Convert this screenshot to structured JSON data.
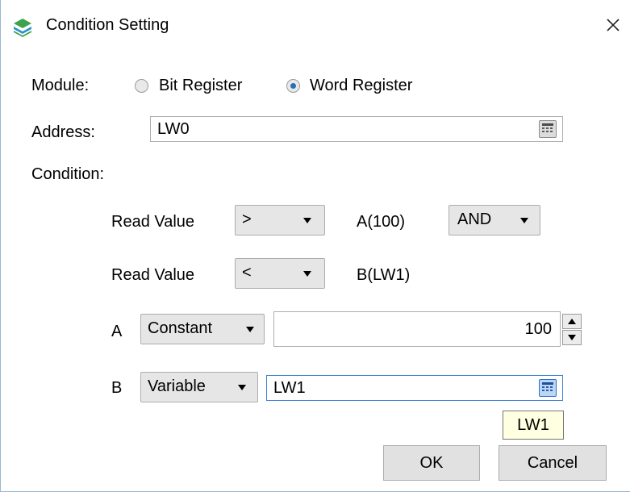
{
  "window": {
    "title": "Condition Setting",
    "icon": "app-stack-icon",
    "close_icon": "close-icon"
  },
  "module": {
    "label": "Module:",
    "options": [
      {
        "label": "Bit Register",
        "checked": false
      },
      {
        "label": "Word Register",
        "checked": true
      }
    ]
  },
  "address": {
    "label": "Address:",
    "value": "LW0"
  },
  "condition": {
    "label": "Condition:",
    "rows": [
      {
        "label": "Read Value",
        "operator": ">",
        "operand": "A(100)",
        "logic": "AND"
      },
      {
        "label": "Read Value",
        "operator": "<",
        "operand": "B(LW1)"
      }
    ]
  },
  "param_a": {
    "label": "A",
    "type": "Constant",
    "value": "100"
  },
  "param_b": {
    "label": "B",
    "type": "Variable",
    "value": "LW1"
  },
  "tooltip": "LW1",
  "buttons": {
    "ok": "OK",
    "cancel": "Cancel"
  },
  "colors": {
    "accent": "#2d6db5",
    "tooltip_bg": "#ffffe1",
    "focus_border": "#3c7fd6"
  }
}
